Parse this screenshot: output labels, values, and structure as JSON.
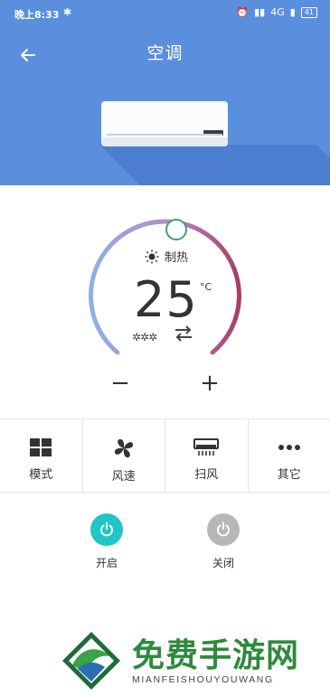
{
  "status_bar": {
    "time": "晚上8:33",
    "network": "4G",
    "battery": "41"
  },
  "header": {
    "title": "空调",
    "back_icon": "arrow-left-icon"
  },
  "thermostat": {
    "mode_label": "制热",
    "mode_icon": "sun-icon",
    "temperature": "25",
    "unit": "°C",
    "wind_icon": "fan-speed-icon",
    "swing_icon": "swap-arrows-icon",
    "decrease_label": "−",
    "increase_label": "+",
    "arc_colors": [
      "#8fb0e6",
      "#b58ac4",
      "#a63e6b"
    ]
  },
  "controls": [
    {
      "label": "模式",
      "icon": "mode-grid-icon"
    },
    {
      "label": "风速",
      "icon": "fan-icon"
    },
    {
      "label": "扫风",
      "icon": "swing-air-icon"
    },
    {
      "label": "其它",
      "icon": "more-dots-icon"
    }
  ],
  "power": {
    "on_label": "开启",
    "off_label": "关闭",
    "on_color": "#1fc6c6",
    "off_color": "#b7b7b7"
  },
  "watermark": {
    "text": "免费手游网",
    "sub": "MIANFEISHOUYOUWANG"
  },
  "colors": {
    "header_bg": "#5a8fde"
  }
}
